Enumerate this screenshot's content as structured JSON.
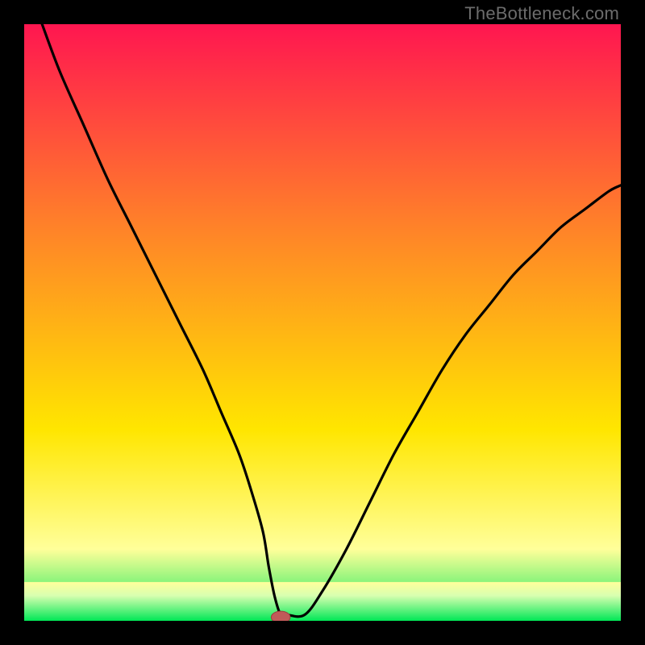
{
  "watermark": "TheBottleneck.com",
  "colors": {
    "bg": "#000000",
    "curve": "#000000",
    "marker_fill": "#c15a59",
    "marker_stroke": "#9a3f3e",
    "gradient": {
      "top": "#ff1650",
      "upper_mid": "#ff7f2a",
      "mid": "#ffe600",
      "lower_mid": "#ffff9a",
      "bottom": "#00e756"
    }
  },
  "chart_data": {
    "type": "line",
    "title": "",
    "xlabel": "",
    "ylabel": "",
    "xlim": [
      0,
      100
    ],
    "ylim": [
      0,
      100
    ],
    "curve": {
      "x": [
        3,
        6,
        10,
        14,
        18,
        22,
        26,
        30,
        33,
        36,
        38,
        40,
        41,
        42,
        43,
        44,
        47,
        50,
        54,
        58,
        62,
        66,
        70,
        74,
        78,
        82,
        86,
        90,
        94,
        98,
        100
      ],
      "y": [
        100,
        92,
        83,
        74,
        66,
        58,
        50,
        42,
        35,
        28,
        22,
        15,
        9,
        4,
        1,
        1,
        1,
        5,
        12,
        20,
        28,
        35,
        42,
        48,
        53,
        58,
        62,
        66,
        69,
        72,
        73
      ]
    },
    "marker": {
      "x": 43,
      "y": 0.6,
      "rx": 1.6,
      "ry": 1.0
    },
    "bottom_band_limits": [
      93.5,
      100
    ]
  }
}
